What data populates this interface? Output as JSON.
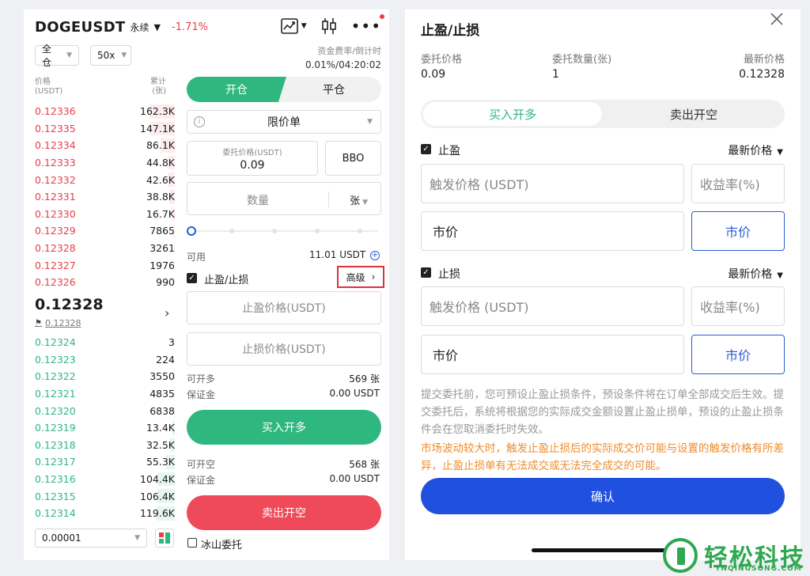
{
  "header": {
    "symbol": "DOGEUSDT",
    "contract_type": "永续",
    "change": "-1.71%",
    "colors": {
      "up": "#2fb780",
      "down": "#e8404a",
      "accent": "#2a5bd7"
    }
  },
  "controls": {
    "margin_mode": "全仓",
    "leverage": "50x",
    "funding_label": "资金费率/倒计时",
    "funding_value": "0.01%/04:20:02"
  },
  "orderbook": {
    "price_header": "价格",
    "price_unit": "(USDT)",
    "size_header": "累计",
    "size_unit": "(张)",
    "asks": [
      {
        "price": "0.12336",
        "size": "162.3K",
        "depth": 0.18
      },
      {
        "price": "0.12335",
        "size": "147.1K",
        "depth": 0.17
      },
      {
        "price": "0.12334",
        "size": "86.1K",
        "depth": 0.1
      },
      {
        "price": "0.12333",
        "size": "44.8K",
        "depth": 0.05
      },
      {
        "price": "0.12332",
        "size": "42.6K",
        "depth": 0.05
      },
      {
        "price": "0.12331",
        "size": "38.8K",
        "depth": 0.04
      },
      {
        "price": "0.12330",
        "size": "16.7K",
        "depth": 0.02
      },
      {
        "price": "0.12329",
        "size": "7865",
        "depth": 0.01
      },
      {
        "price": "0.12328",
        "size": "3261",
        "depth": 0.004
      },
      {
        "price": "0.12327",
        "size": "1976",
        "depth": 0.002
      },
      {
        "price": "0.12326",
        "size": "990",
        "depth": 0.001
      }
    ],
    "last_price": "0.12328",
    "mark_price": "0.12328",
    "bids": [
      {
        "price": "0.12324",
        "size": "3",
        "depth": 0.0
      },
      {
        "price": "0.12323",
        "size": "224",
        "depth": 0.001
      },
      {
        "price": "0.12322",
        "size": "3550",
        "depth": 0.004
      },
      {
        "price": "0.12321",
        "size": "4835",
        "depth": 0.005
      },
      {
        "price": "0.12320",
        "size": "6838",
        "depth": 0.008
      },
      {
        "price": "0.12319",
        "size": "13.4K",
        "depth": 0.015
      },
      {
        "price": "0.12318",
        "size": "32.5K",
        "depth": 0.036
      },
      {
        "price": "0.12317",
        "size": "55.3K",
        "depth": 0.06
      },
      {
        "price": "0.12316",
        "size": "104.4K",
        "depth": 0.12
      },
      {
        "price": "0.12315",
        "size": "106.4K",
        "depth": 0.12
      },
      {
        "price": "0.12314",
        "size": "119.6K",
        "depth": 0.13
      }
    ],
    "depth_step": "0.00001"
  },
  "order_form": {
    "tab_open": "开仓",
    "tab_close": "平仓",
    "order_type": "限价单",
    "price_label": "委托价格(USDT)",
    "price_value": "0.09",
    "bbo": "BBO",
    "qty_placeholder": "数量",
    "qty_unit": "张",
    "available_label": "可用",
    "available_value": "11.01 USDT",
    "tpsl_label": "止盈/止损",
    "advanced": "高级",
    "tp_placeholder": "止盈价格(USDT)",
    "sl_placeholder": "止损价格(USDT)",
    "long_max_label": "可开多",
    "long_max_value": "569 张",
    "long_margin_label": "保证金",
    "long_margin_value": "0.00 USDT",
    "buy_button": "买入开多",
    "short_max_label": "可开空",
    "short_max_value": "568 张",
    "short_margin_label": "保证金",
    "short_margin_value": "0.00 USDT",
    "sell_button": "卖出开空",
    "iceberg": "冰山委托"
  },
  "tpsl_dialog": {
    "title": "止盈/止损",
    "order_price_label": "委托价格",
    "order_price": "0.09",
    "order_qty_label": "委托数量(张)",
    "order_qty": "1",
    "latest_price_label": "最新价格",
    "latest_price": "0.12328",
    "tab_buy": "买入开多",
    "tab_sell": "卖出开空",
    "tp": {
      "label": "止盈",
      "trigger_type": "最新价格",
      "trigger_placeholder": "触发价格 (USDT)",
      "roi_placeholder": "收益率(%)",
      "exec_value": "市价",
      "exec_button": "市价"
    },
    "sl": {
      "label": "止损",
      "trigger_type": "最新价格",
      "trigger_placeholder": "触发价格 (USDT)",
      "roi_placeholder": "收益率(%)",
      "exec_value": "市价",
      "exec_button": "市价"
    },
    "note": "提交委托前，您可预设止盈止损条件，预设条件将在订单全部成交后生效。提交委托后，系统将根据您的实际成交金额设置止盈止损单，预设的止盈止损条件会在您取消委托时失效。",
    "warning": "市场波动较大时，触发止盈止损后的实际成交价可能与设置的触发价格有所差异，止盈止损单有无法成交或无法完全成交的可能。",
    "confirm": "确认"
  },
  "watermark": {
    "text": "轻松科技",
    "sub": "YNQINGSONG.COM"
  }
}
